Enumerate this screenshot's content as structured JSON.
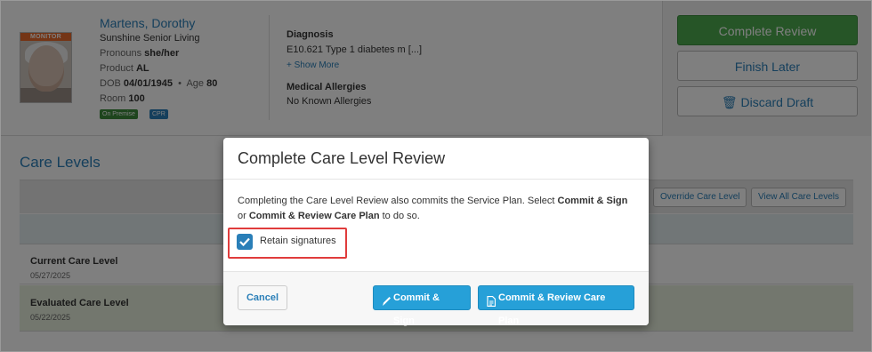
{
  "resident": {
    "name": "Martens, Dorothy",
    "facility": "Sunshine Senior Living",
    "pronouns_label": "Pronouns",
    "pronouns": "she/her",
    "product_label": "Product",
    "product": "AL",
    "dob_label": "DOB",
    "dob": "04/01/1945",
    "age_label": "Age",
    "age": "80",
    "room_label": "Room",
    "room": "100",
    "photo_banner": "MONITOR",
    "tags": [
      "On Premise",
      "CPR"
    ]
  },
  "diagnosis": {
    "title": "Diagnosis",
    "value": "E10.621 Type 1 diabetes m [...]",
    "show_more": "+ Show More"
  },
  "allergies": {
    "title": "Medical Allergies",
    "value": "No Known Allergies"
  },
  "actions": {
    "complete_review": "Complete Review",
    "finish_later": "Finish Later",
    "discard_draft": "🗑 Discard Draft"
  },
  "care_levels": {
    "title": "Care Levels",
    "override_button": "Override Care Level",
    "view_all_button": "View All Care Levels",
    "rows": [
      {
        "title": "Current Care Level",
        "date": "05/27/2025"
      },
      {
        "title": "Evaluated Care Level",
        "date": "05/22/2025"
      }
    ]
  },
  "modal": {
    "title": "Complete Care Level Review",
    "body_prefix": "Completing the Care Level Review also commits the Service Plan. Select ",
    "body_bold1": "Commit & Sign",
    "body_mid": " or ",
    "body_bold2": "Commit & Review Care Plan",
    "body_suffix": " to do so.",
    "checkbox_label": "Retain signatures",
    "checkbox_checked": true,
    "cancel": "Cancel",
    "commit_sign": "Commit & Sign",
    "commit_review": "Commit & Review Care Plan"
  },
  "colors": {
    "accent_blue": "#2a7fb8",
    "button_blue": "#26a0d8",
    "complete_green": "#4caa4e",
    "highlight_red": "#e03c3c"
  }
}
